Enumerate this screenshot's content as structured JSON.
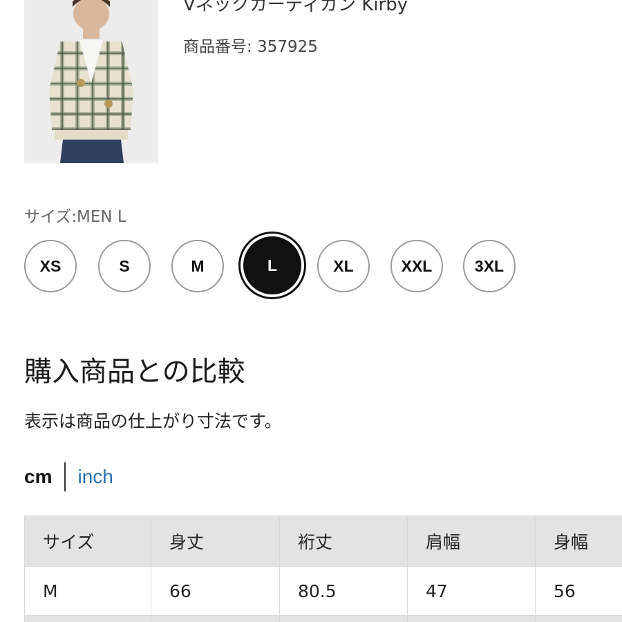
{
  "product": {
    "title": "Vネックカーディガン Kirby",
    "number": "商品番号: 357925"
  },
  "size_selector": {
    "label": "サイズ:MEN L",
    "options": [
      "XS",
      "S",
      "M",
      "L",
      "XL",
      "XXL",
      "3XL"
    ],
    "selected": "L"
  },
  "comparison": {
    "title": "購入商品との比較",
    "description": "表示は商品の仕上がり寸法です。",
    "units": {
      "cm": "cm",
      "inch": "inch",
      "active": "cm"
    }
  },
  "table": {
    "headers": [
      "サイズ",
      "身丈",
      "裄丈",
      "肩幅",
      "身幅"
    ],
    "rows": [
      [
        "M",
        "66",
        "80.5",
        "47",
        "56"
      ]
    ]
  },
  "colors": {
    "accent_link": "#2b6fb5",
    "selected_chip": "#111111",
    "table_header_bg": "#e3e3e3"
  }
}
